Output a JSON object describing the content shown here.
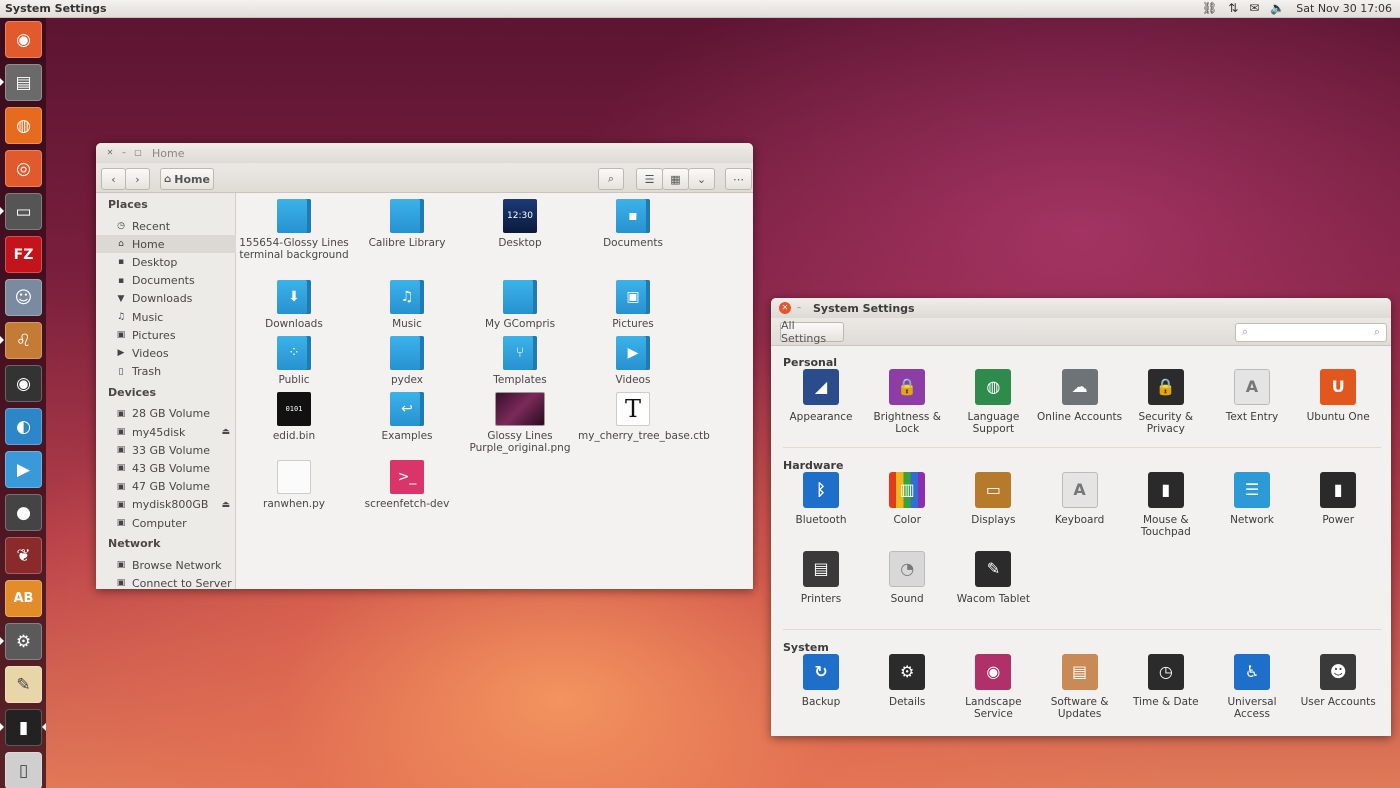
{
  "top_panel": {
    "title": "System Settings",
    "clock": "Sat Nov 30  17:06",
    "indicators": [
      "network-icon",
      "transfer-icon",
      "messaging-icon",
      "volume-icon"
    ]
  },
  "launcher": {
    "items": [
      {
        "name": "dash-home",
        "color": "#e05a2b"
      },
      {
        "name": "files",
        "color": "#6a6a6a"
      },
      {
        "name": "firefox",
        "color": "#e66b1f"
      },
      {
        "name": "ubuntu-software",
        "color": "#e05a2b"
      },
      {
        "name": "system-monitor",
        "color": "#555555"
      },
      {
        "name": "filezilla",
        "color": "#c4141b"
      },
      {
        "name": "pidgin",
        "color": "#7a8aa0"
      },
      {
        "name": "lion-app",
        "color": "#c47b35"
      },
      {
        "name": "camera",
        "color": "#333333"
      },
      {
        "name": "browser",
        "color": "#2c86c8"
      },
      {
        "name": "media-player",
        "color": "#3a9ad9"
      },
      {
        "name": "webcam",
        "color": "#444444"
      },
      {
        "name": "cherry",
        "color": "#8a2a2a"
      },
      {
        "name": "dictionary",
        "color": "#e28c2a"
      },
      {
        "name": "system-settings",
        "color": "#5a5a5a"
      },
      {
        "name": "notes",
        "color": "#e8d6a8"
      },
      {
        "name": "usb-device",
        "color": "#222222"
      },
      {
        "name": "trash",
        "color": "#cfcfcf"
      }
    ],
    "dictionary_glyph": "AB",
    "filezilla_glyph": "FZ"
  },
  "file_manager": {
    "window_title": "Home",
    "location": "Home",
    "sidebar": {
      "places_heading": "Places",
      "places": [
        {
          "label": "Recent",
          "icon": "clock-icon"
        },
        {
          "label": "Home",
          "icon": "home-icon"
        },
        {
          "label": "Desktop",
          "icon": "desktop-icon"
        },
        {
          "label": "Documents",
          "icon": "documents-icon"
        },
        {
          "label": "Downloads",
          "icon": "downloads-icon"
        },
        {
          "label": "Music",
          "icon": "music-icon"
        },
        {
          "label": "Pictures",
          "icon": "pictures-icon"
        },
        {
          "label": "Videos",
          "icon": "videos-icon"
        },
        {
          "label": "Trash",
          "icon": "trash-icon"
        }
      ],
      "devices_heading": "Devices",
      "devices": [
        {
          "label": "28 GB Volume",
          "eject": false
        },
        {
          "label": "my45disk",
          "eject": true
        },
        {
          "label": "33 GB Volume",
          "eject": false
        },
        {
          "label": "43 GB Volume",
          "eject": false
        },
        {
          "label": "47 GB Volume",
          "eject": false
        },
        {
          "label": "mydisk800GB",
          "eject": true
        },
        {
          "label": "Computer",
          "eject": false
        }
      ],
      "network_heading": "Network",
      "network": [
        {
          "label": "Browse Network"
        },
        {
          "label": "Connect to Server"
        }
      ]
    },
    "files": [
      {
        "name": "155654-Glossy Lines terminal background",
        "kind": "folder"
      },
      {
        "name": "Calibre Library",
        "kind": "folder"
      },
      {
        "name": "Desktop",
        "kind": "desktop",
        "clock": "12:30"
      },
      {
        "name": "Documents",
        "kind": "folder"
      },
      {
        "name": "Downloads",
        "kind": "folder"
      },
      {
        "name": "Music",
        "kind": "folder"
      },
      {
        "name": "My GCompris",
        "kind": "folder"
      },
      {
        "name": "Pictures",
        "kind": "folder"
      },
      {
        "name": "Public",
        "kind": "folder"
      },
      {
        "name": "pydex",
        "kind": "folder"
      },
      {
        "name": "Templates",
        "kind": "folder"
      },
      {
        "name": "Videos",
        "kind": "folder"
      },
      {
        "name": "edid.bin",
        "kind": "binary"
      },
      {
        "name": "Examples",
        "kind": "folder"
      },
      {
        "name": "Glossy Lines Purple_original.png",
        "kind": "image"
      },
      {
        "name": "my_cherry_tree_base.ctb",
        "kind": "text"
      },
      {
        "name": "ranwhen.py",
        "kind": "python"
      },
      {
        "name": "screenfetch-dev",
        "kind": "script"
      }
    ]
  },
  "system_settings": {
    "window_title": "System Settings",
    "all_settings_label": "All Settings",
    "search_placeholder": "",
    "categories": [
      {
        "heading": "Personal",
        "items": [
          {
            "label": "Appearance",
            "color": "#2a4c8a"
          },
          {
            "label": "Brightness & Lock",
            "color": "#8e3ca6"
          },
          {
            "label": "Language Support",
            "color": "#2f8b4c"
          },
          {
            "label": "Online Accounts",
            "color": "#6e7378"
          },
          {
            "label": "Security & Privacy",
            "color": "#2b2b2b"
          },
          {
            "label": "Text Entry",
            "color": "#e4e4e4"
          },
          {
            "label": "Ubuntu One",
            "color": "#e2571e"
          }
        ]
      },
      {
        "heading": "Hardware",
        "items": [
          {
            "label": "Bluetooth",
            "color": "#1d6fc9"
          },
          {
            "label": "Color",
            "color": "#d94c1b"
          },
          {
            "label": "Displays",
            "color": "#b67a2a"
          },
          {
            "label": "Keyboard",
            "color": "#e4e4e4"
          },
          {
            "label": "Mouse & Touchpad",
            "color": "#2a2a2a"
          },
          {
            "label": "Network",
            "color": "#2b9ad6"
          },
          {
            "label": "Power",
            "color": "#2a2a2a"
          },
          {
            "label": "Printers",
            "color": "#3a3a3a"
          },
          {
            "label": "Sound",
            "color": "#d8d8d8"
          },
          {
            "label": "Wacom Tablet",
            "color": "#2b2b2b"
          }
        ]
      },
      {
        "heading": "System",
        "items": [
          {
            "label": "Backup",
            "color": "#1d6fc9"
          },
          {
            "label": "Details",
            "color": "#2b2b2b"
          },
          {
            "label": "Landscape Service",
            "color": "#b0306a"
          },
          {
            "label": "Software & Updates",
            "color": "#c98a55"
          },
          {
            "label": "Time & Date",
            "color": "#2b2b2b"
          },
          {
            "label": "Universal Access",
            "color": "#1d6fc9"
          },
          {
            "label": "User Accounts",
            "color": "#3a3a3a"
          }
        ]
      }
    ]
  }
}
